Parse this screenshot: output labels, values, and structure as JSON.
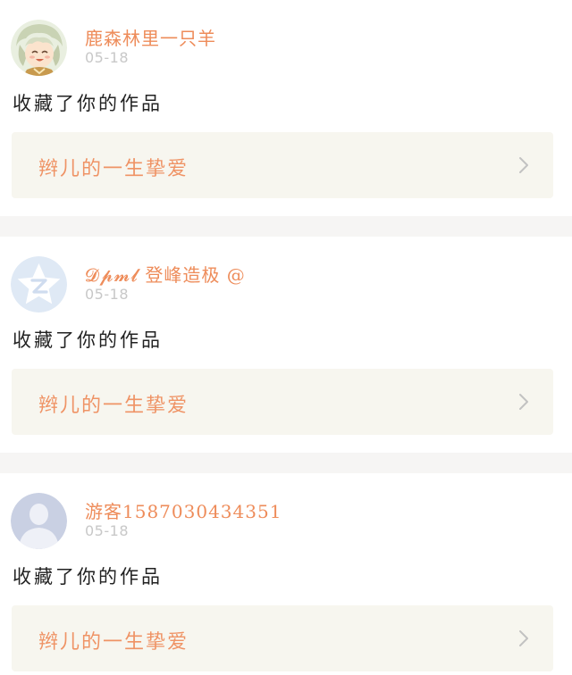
{
  "colors": {
    "username": "#ee8c5a",
    "work_title": "#ef9365",
    "timestamp": "#c8c8c8",
    "link_background": "#f7f6ef",
    "separator": "#f6f5f4"
  },
  "notifications": [
    {
      "avatar_icon": "anime-character-avatar-icon",
      "username": "鹿森林里一只羊",
      "timestamp": "05-18",
      "action": "收藏了你的作品",
      "work_title": "辫儿的一生挚爱",
      "chevron_icon": "chevron-right-icon"
    },
    {
      "avatar_icon": "qzone-logo-avatar-icon",
      "username": "𝓓𝓹𝓶𝓵 登峰造极 @",
      "timestamp": "05-18",
      "action": "收藏了你的作品",
      "work_title": "辫儿的一生挚爱",
      "chevron_icon": "chevron-right-icon"
    },
    {
      "avatar_icon": "default-user-avatar-icon",
      "username": "游客1587030434351",
      "timestamp": "05-18",
      "action": "收藏了你的作品",
      "work_title": "辫儿的一生挚爱",
      "chevron_icon": "chevron-right-icon"
    }
  ]
}
